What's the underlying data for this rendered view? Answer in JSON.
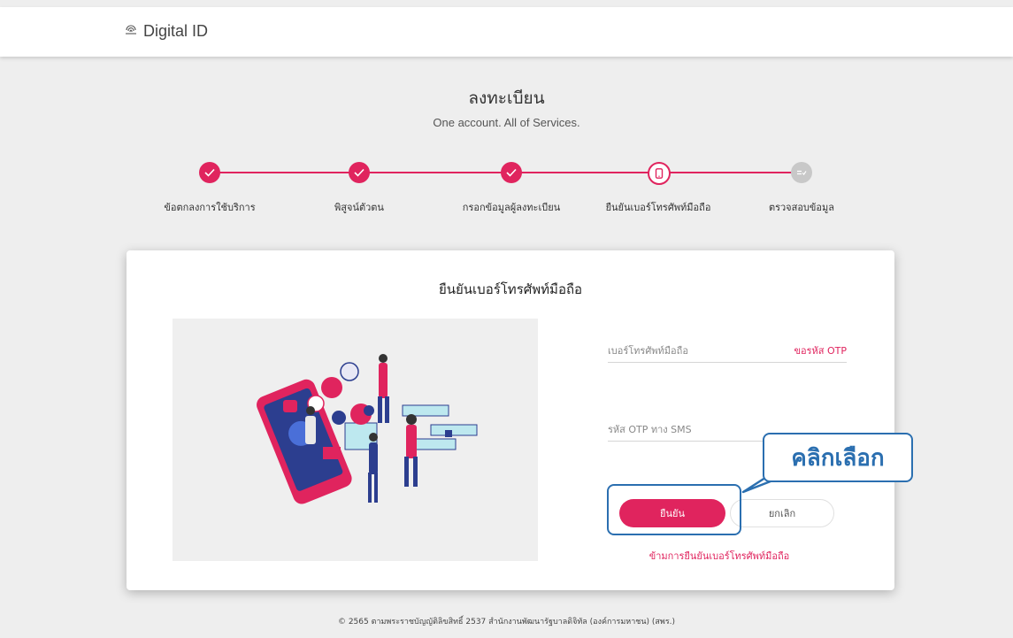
{
  "header": {
    "logo_text": "Digital ID",
    "logo_icon": "fingerprint-icon"
  },
  "page": {
    "title": "ลงทะเบียน",
    "subtitle": "One account. All of Services."
  },
  "steps": [
    {
      "label": "ข้อตกลงการใช้บริการ",
      "status": "done",
      "icon": "check-icon"
    },
    {
      "label": "พิสูจน์ตัวตน",
      "status": "done",
      "icon": "check-icon"
    },
    {
      "label": "กรอกข้อมูลผู้ลงทะเบียน",
      "status": "done",
      "icon": "check-icon"
    },
    {
      "label": "ยืนยันเบอร์โทรศัพท์มือถือ",
      "status": "active",
      "icon": "mobile-phone-icon"
    },
    {
      "label": "ตรวจสอบข้อมูล",
      "status": "pending",
      "icon": "review-icon"
    }
  ],
  "card": {
    "title": "ยืนยันเบอร์โทรศัพท์มือถือ",
    "phone_placeholder": "เบอร์โทรศัพท์มือถือ",
    "request_otp_label": "ขอรหัส OTP",
    "otp_placeholder": "รหัส OTP ทาง SMS",
    "confirm_label": "ยืนยัน",
    "cancel_label": "ยกเลิก",
    "skip_label": "ข้ามการยืนยันเบอร์โทรศัพท์มือถือ"
  },
  "annotation": {
    "callout_text": "คลิกเลือก"
  },
  "footer": {
    "text": "© 2565 ตามพระราชบัญญัติลิขสิทธิ์ 2537 สำนักงานพัฒนารัฐบาลดิจิทัล (องค์การมหาชน) (สพร.)"
  },
  "colors": {
    "accent": "#e0245e",
    "annotation": "#2b6fb0",
    "pending": "#c8c8c8",
    "background": "#eeeeee"
  }
}
